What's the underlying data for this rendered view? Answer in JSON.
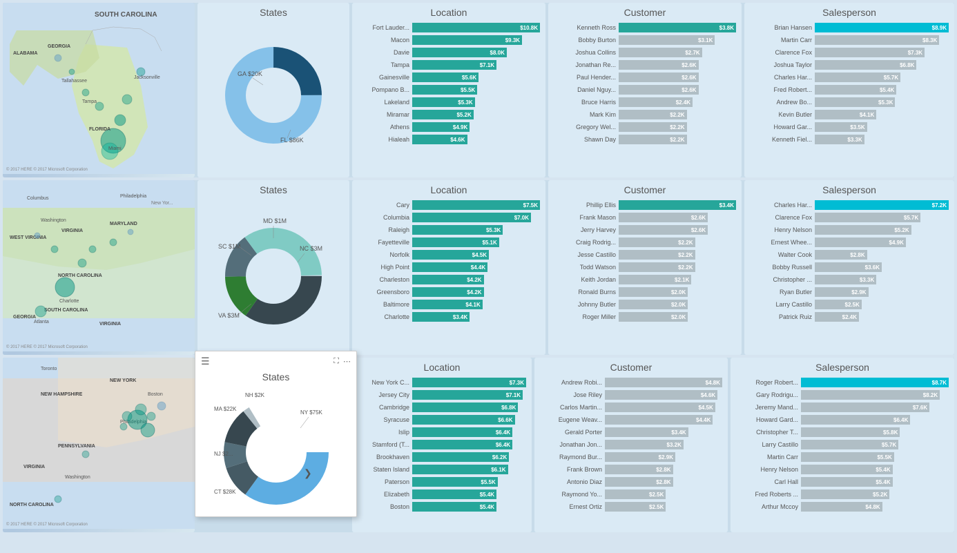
{
  "colors": {
    "teal_bright": "#00c4b4",
    "teal_dark": "#00897b",
    "green_bright": "#26a69a",
    "green_mid": "#4db6ac",
    "blue_dark": "#1a5276",
    "blue_mid": "#2980b9",
    "blue_light": "#5dade2",
    "blue_lighter": "#85c1e9",
    "dark_teal": "#00695c",
    "medium_blue": "#1565c0",
    "slate_blue": "#2471a3",
    "gray_green": "#5d8a6e",
    "dark_green": "#1b5e20",
    "mid_green": "#388e3c",
    "accent_blue": "#1976d2"
  },
  "rows": [
    {
      "id": "row1",
      "map": {
        "title": "SOUTH CAROLINA",
        "labels": [
          "Jacksonville",
          "Tallahassee",
          "Tampa",
          "Miami",
          "FLORIDA",
          "ALABAMA",
          "GEORGIA"
        ]
      },
      "states": {
        "title": "States",
        "segments": [
          {
            "label": "GA $20K",
            "color": "#1a5276",
            "pct": 25
          },
          {
            "label": "FL $86K",
            "color": "#85c1e9",
            "pct": 75
          }
        ]
      },
      "location": {
        "title": "Location",
        "bars": [
          {
            "label": "Fort Lauder...",
            "value": "$10.8K",
            "pct": 100,
            "color": "#26a69a"
          },
          {
            "label": "Macon",
            "value": "$9.3K",
            "pct": 86,
            "color": "#26a69a"
          },
          {
            "label": "Davie",
            "value": "$8.0K",
            "pct": 74,
            "color": "#26a69a"
          },
          {
            "label": "Tampa",
            "value": "$7.1K",
            "pct": 66,
            "color": "#26a69a"
          },
          {
            "label": "Gainesville",
            "value": "$5.6K",
            "pct": 52,
            "color": "#26a69a"
          },
          {
            "label": "Pompano B...",
            "value": "$5.5K",
            "pct": 51,
            "color": "#26a69a"
          },
          {
            "label": "Lakeland",
            "value": "$5.3K",
            "pct": 49,
            "color": "#26a69a"
          },
          {
            "label": "Miramar",
            "value": "$5.2K",
            "pct": 48,
            "color": "#26a69a"
          },
          {
            "label": "Athens",
            "value": "$4.9K",
            "pct": 45,
            "color": "#26a69a"
          },
          {
            "label": "Hialeah",
            "value": "$4.6K",
            "pct": 43,
            "color": "#26a69a"
          }
        ]
      },
      "customer": {
        "title": "Customer",
        "bars": [
          {
            "label": "Kenneth Ross",
            "value": "$3.8K",
            "pct": 100,
            "color": "#26a69a",
            "bold": true
          },
          {
            "label": "Bobby Burton",
            "value": "$3.1K",
            "pct": 82,
            "color": "#b0bec5",
            "bold": false
          },
          {
            "label": "Joshua Collins",
            "value": "$2.7K",
            "pct": 71,
            "color": "#b0bec5",
            "bold": false
          },
          {
            "label": "Jonathan Re...",
            "value": "$2.6K",
            "pct": 68,
            "color": "#b0bec5",
            "bold": false
          },
          {
            "label": "Paul Hender...",
            "value": "$2.6K",
            "pct": 68,
            "color": "#b0bec5",
            "bold": false
          },
          {
            "label": "Daniel Nguy...",
            "value": "$2.6K",
            "pct": 68,
            "color": "#b0bec5",
            "bold": false
          },
          {
            "label": "Bruce Harris",
            "value": "$2.4K",
            "pct": 63,
            "color": "#b0bec5",
            "bold": false
          },
          {
            "label": "Mark Kim",
            "value": "$2.2K",
            "pct": 58,
            "color": "#b0bec5",
            "bold": false
          },
          {
            "label": "Gregory Wel...",
            "value": "$2.2K",
            "pct": 58,
            "color": "#b0bec5",
            "bold": false
          },
          {
            "label": "Shawn Day",
            "value": "$2.2K",
            "pct": 58,
            "color": "#b0bec5",
            "bold": false
          }
        ]
      },
      "salesperson": {
        "title": "Salesperson",
        "bars": [
          {
            "label": "Brian Hansen",
            "value": "$8.9K",
            "pct": 100,
            "color": "#00bcd4",
            "bold": true
          },
          {
            "label": "Martin Carr",
            "value": "$8.3K",
            "pct": 93,
            "color": "#b0bec5",
            "bold": false
          },
          {
            "label": "Clarence Fox",
            "value": "$7.3K",
            "pct": 82,
            "color": "#b0bec5",
            "bold": false
          },
          {
            "label": "Joshua Taylor",
            "value": "$6.8K",
            "pct": 76,
            "color": "#b0bec5",
            "bold": false
          },
          {
            "label": "Charles Har...",
            "value": "$5.7K",
            "pct": 64,
            "color": "#b0bec5",
            "bold": false
          },
          {
            "label": "Fred Robert...",
            "value": "$5.4K",
            "pct": 61,
            "color": "#b0bec5",
            "bold": false
          },
          {
            "label": "Andrew Bo...",
            "value": "$5.3K",
            "pct": 60,
            "color": "#b0bec5",
            "bold": false
          },
          {
            "label": "Kevin Butler",
            "value": "$4.1K",
            "pct": 46,
            "color": "#b0bec5",
            "bold": false
          },
          {
            "label": "Howard Gar...",
            "value": "$3.5K",
            "pct": 39,
            "color": "#b0bec5",
            "bold": false
          },
          {
            "label": "Kenneth Fiel...",
            "value": "$3.3K",
            "pct": 37,
            "color": "#b0bec5",
            "bold": false
          }
        ]
      }
    },
    {
      "id": "row2",
      "map": {
        "labels": [
          "Columbus",
          "Philadelphia",
          "Washington",
          "WEST VIRGINIA",
          "VIRGINIA",
          "Charlotte",
          "Atlanta",
          "SOUTH CAROLINA",
          "GEORGIA",
          "NORTH CAROLINA"
        ]
      },
      "states": {
        "title": "States",
        "segments": [
          {
            "label": "MD $1M",
            "color": "#1a5276",
            "pct": 15
          },
          {
            "label": "SC $1M",
            "color": "#2e7d32",
            "pct": 15
          },
          {
            "label": "NC $3M",
            "color": "#80cbc4",
            "pct": 35
          },
          {
            "label": "VA $3M",
            "color": "#37474f",
            "pct": 35
          }
        ]
      },
      "location": {
        "title": "Location",
        "bars": [
          {
            "label": "Cary",
            "value": "$7.5K",
            "pct": 100,
            "color": "#26a69a",
            "bold": true
          },
          {
            "label": "Columbia",
            "value": "$7.0K",
            "pct": 93,
            "color": "#26a69a",
            "bold": true
          },
          {
            "label": "Raleigh",
            "value": "$5.3K",
            "pct": 71,
            "color": "#26a69a"
          },
          {
            "label": "Fayetteville",
            "value": "$5.1K",
            "pct": 68,
            "color": "#26a69a"
          },
          {
            "label": "Norfolk",
            "value": "$4.5K",
            "pct": 60,
            "color": "#26a69a"
          },
          {
            "label": "High Point",
            "value": "$4.4K",
            "pct": 59,
            "color": "#26a69a"
          },
          {
            "label": "Charleston",
            "value": "$4.2K",
            "pct": 56,
            "color": "#26a69a"
          },
          {
            "label": "Greensboro",
            "value": "$4.2K",
            "pct": 56,
            "color": "#26a69a"
          },
          {
            "label": "Baltimore",
            "value": "$4.1K",
            "pct": 55,
            "color": "#26a69a"
          },
          {
            "label": "Charlotte",
            "value": "$3.4K",
            "pct": 45,
            "color": "#26a69a"
          }
        ]
      },
      "customer": {
        "title": "Customer",
        "bars": [
          {
            "label": "Phillip Ellis",
            "value": "$3.4K",
            "pct": 100,
            "color": "#26a69a",
            "bold": true
          },
          {
            "label": "Frank Mason",
            "value": "$2.6K",
            "pct": 76,
            "color": "#b0bec5"
          },
          {
            "label": "Jerry Harvey",
            "value": "$2.6K",
            "pct": 76,
            "color": "#b0bec5"
          },
          {
            "label": "Craig Rodrig...",
            "value": "$2.2K",
            "pct": 65,
            "color": "#b0bec5"
          },
          {
            "label": "Jesse Castillo",
            "value": "$2.2K",
            "pct": 65,
            "color": "#b0bec5"
          },
          {
            "label": "Todd Watson",
            "value": "$2.2K",
            "pct": 65,
            "color": "#b0bec5"
          },
          {
            "label": "Keith Jordan",
            "value": "$2.1K",
            "pct": 62,
            "color": "#b0bec5"
          },
          {
            "label": "Ronald Burns",
            "value": "$2.0K",
            "pct": 59,
            "color": "#b0bec5"
          },
          {
            "label": "Johnny Butler",
            "value": "$2.0K",
            "pct": 59,
            "color": "#b0bec5"
          },
          {
            "label": "Roger Miller",
            "value": "$2.0K",
            "pct": 59,
            "color": "#b0bec5"
          }
        ]
      },
      "salesperson": {
        "title": "Salesperson",
        "bars": [
          {
            "label": "Charles Har...",
            "value": "$7.2K",
            "pct": 100,
            "color": "#00bcd4",
            "bold": true
          },
          {
            "label": "Clarence Fox",
            "value": "$5.7K",
            "pct": 79,
            "color": "#b0bec5"
          },
          {
            "label": "Henry Nelson",
            "value": "$5.2K",
            "pct": 72,
            "color": "#b0bec5"
          },
          {
            "label": "Ernest Whee...",
            "value": "$4.9K",
            "pct": 68,
            "color": "#b0bec5"
          },
          {
            "label": "Walter Cook",
            "value": "$2.8K",
            "pct": 39,
            "color": "#b0bec5"
          },
          {
            "label": "Bobby Russell",
            "value": "$3.6K",
            "pct": 50,
            "color": "#b0bec5"
          },
          {
            "label": "Christopher ...",
            "value": "$3.3K",
            "pct": 46,
            "color": "#b0bec5"
          },
          {
            "label": "Ryan Butler",
            "value": "$2.9K",
            "pct": 40,
            "color": "#b0bec5"
          },
          {
            "label": "Larry Castillo",
            "value": "$2.5K",
            "pct": 35,
            "color": "#b0bec5"
          },
          {
            "label": "Patrick Ruiz",
            "value": "$2.4K",
            "pct": 33,
            "color": "#b0bec5"
          }
        ]
      }
    },
    {
      "id": "row3",
      "map": {
        "labels": [
          "Toronto",
          "NEW YORK",
          "Boston",
          "Philadelphia",
          "PENNSYLVANIA",
          "VIRGINIA",
          "Washington",
          "NEW HAMPSHIRE",
          "NORTH CAROLINA"
        ]
      },
      "states_popup": {
        "title": "States",
        "segments": [
          {
            "label": "NH $2K",
            "color": "#b0bec5",
            "pct": 2
          },
          {
            "label": "MA $22K",
            "color": "#455a64",
            "pct": 10
          },
          {
            "label": "NJ $2...",
            "color": "#37474f",
            "pct": 8
          },
          {
            "label": "CT $28K",
            "color": "#546e7a",
            "pct": 11
          },
          {
            "label": "NY $75K",
            "color": "#5dade2",
            "pct": 35
          }
        ]
      },
      "location": {
        "title": "Location",
        "bars": [
          {
            "label": "New York C...",
            "value": "$7.3K",
            "pct": 100,
            "color": "#26a69a",
            "bold": true
          },
          {
            "label": "Jersey City",
            "value": "$7.1K",
            "pct": 97,
            "color": "#26a69a",
            "bold": true
          },
          {
            "label": "Cambridge",
            "value": "$6.8K",
            "pct": 93,
            "color": "#26a69a",
            "bold": true
          },
          {
            "label": "Syracuse",
            "value": "$6.6K",
            "pct": 90,
            "color": "#26a69a",
            "bold": true
          },
          {
            "label": "Islip",
            "value": "$6.4K",
            "pct": 88,
            "color": "#26a69a"
          },
          {
            "label": "Stamford (T...",
            "value": "$6.4K",
            "pct": 88,
            "color": "#26a69a"
          },
          {
            "label": "Brookhaven",
            "value": "$6.2K",
            "pct": 85,
            "color": "#26a69a"
          },
          {
            "label": "Staten Island",
            "value": "$6.1K",
            "pct": 84,
            "color": "#26a69a"
          },
          {
            "label": "Paterson",
            "value": "$5.5K",
            "pct": 75,
            "color": "#26a69a"
          },
          {
            "label": "Elizabeth",
            "value": "$5.4K",
            "pct": 74,
            "color": "#26a69a"
          },
          {
            "label": "Boston",
            "value": "$5.4K",
            "pct": 74,
            "color": "#26a69a"
          }
        ]
      },
      "customer": {
        "title": "Customer",
        "bars": [
          {
            "label": "Andrew Robi...",
            "value": "$4.8K",
            "pct": 100,
            "color": "#b0bec5"
          },
          {
            "label": "Jose Riley",
            "value": "$4.6K",
            "pct": 96,
            "color": "#b0bec5"
          },
          {
            "label": "Carlos Martin...",
            "value": "$4.5K",
            "pct": 94,
            "color": "#b0bec5"
          },
          {
            "label": "Eugene Weav...",
            "value": "$4.4K",
            "pct": 92,
            "color": "#b0bec5"
          },
          {
            "label": "Gerald Porter",
            "value": "$3.4K",
            "pct": 71,
            "color": "#b0bec5"
          },
          {
            "label": "Jonathan Jon...",
            "value": "$3.2K",
            "pct": 67,
            "color": "#b0bec5"
          },
          {
            "label": "Raymond Bur...",
            "value": "$2.9K",
            "pct": 60,
            "color": "#b0bec5"
          },
          {
            "label": "Frank Brown",
            "value": "$2.8K",
            "pct": 58,
            "color": "#b0bec5"
          },
          {
            "label": "Antonio Diaz",
            "value": "$2.8K",
            "pct": 58,
            "color": "#b0bec5"
          },
          {
            "label": "Raymond Yo...",
            "value": "$2.5K",
            "pct": 52,
            "color": "#b0bec5"
          },
          {
            "label": "Ernest Ortiz",
            "value": "$2.5K",
            "pct": 52,
            "color": "#b0bec5"
          }
        ]
      },
      "salesperson": {
        "title": "Salesperson",
        "bars": [
          {
            "label": "Roger Robert...",
            "value": "$8.7K",
            "pct": 100,
            "color": "#00bcd4",
            "bold": true
          },
          {
            "label": "Gary Rodrigu...",
            "value": "$8.2K",
            "pct": 94,
            "color": "#b0bec5"
          },
          {
            "label": "Jeremy Mand...",
            "value": "$7.6K",
            "pct": 87,
            "color": "#b0bec5"
          },
          {
            "label": "Howard Gard...",
            "value": "$6.4K",
            "pct": 74,
            "color": "#b0bec5"
          },
          {
            "label": "Christopher T...",
            "value": "$5.8K",
            "pct": 67,
            "color": "#b0bec5"
          },
          {
            "label": "Larry Castillo",
            "value": "$5.7K",
            "pct": 66,
            "color": "#b0bec5"
          },
          {
            "label": "Martin Carr",
            "value": "$5.5K",
            "pct": 63,
            "color": "#b0bec5"
          },
          {
            "label": "Henry Nelson",
            "value": "$5.4K",
            "pct": 62,
            "color": "#b0bec5"
          },
          {
            "label": "Carl Hall",
            "value": "$5.4K",
            "pct": 62,
            "color": "#b0bec5"
          },
          {
            "label": "Fred Roberts ...",
            "value": "$5.2K",
            "pct": 60,
            "color": "#b0bec5"
          },
          {
            "label": "Arthur Mccoy",
            "value": "$4.8K",
            "pct": 55,
            "color": "#b0bec5"
          }
        ]
      }
    }
  ]
}
